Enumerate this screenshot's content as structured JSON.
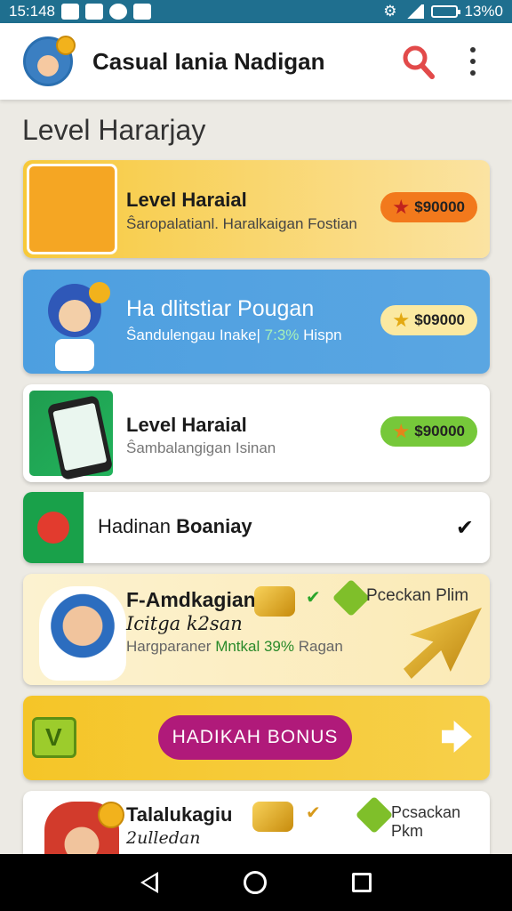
{
  "status_bar": {
    "time": "15:148",
    "battery": "13%0"
  },
  "app_bar": {
    "title": "Casual Iania Nadigan"
  },
  "section": {
    "title": "Level Hararjay"
  },
  "cards": [
    {
      "title": "Level Haraial",
      "subtitle": "Ŝaropalatianl. Haralkaigan Fostian",
      "price": "$90000"
    },
    {
      "title": "Ha dlitstiar Pougan",
      "subtitle_a": "Ŝandulengau Inake|",
      "subtitle_hl": "7:3%",
      "subtitle_b": "Hispn",
      "price": "$09000"
    },
    {
      "title": "Level Haraial",
      "subtitle": "Ŝambalangigan Isinan",
      "price": "$90000"
    },
    {
      "title_a": "Hadinan",
      "title_b": "Boaniay"
    },
    {
      "title": "F-Amdkagian",
      "line2": "Icitga k2san",
      "subtitle_a": "Hargparaner",
      "subtitle_hl": "Mntkal 39%",
      "subtitle_b": "Ragan",
      "promo": "Pceckan Plim"
    },
    {
      "button": "HADIKAH BONUS",
      "icon_letter": "V"
    },
    {
      "title": "Talalukagiu",
      "line2": "2ulledan",
      "promo": "Pcsackan Pkm"
    }
  ],
  "colors": {
    "status_bar": "#1f6f8f",
    "bonus_button": "#b01a7a",
    "accent_green": "#19a14a"
  }
}
